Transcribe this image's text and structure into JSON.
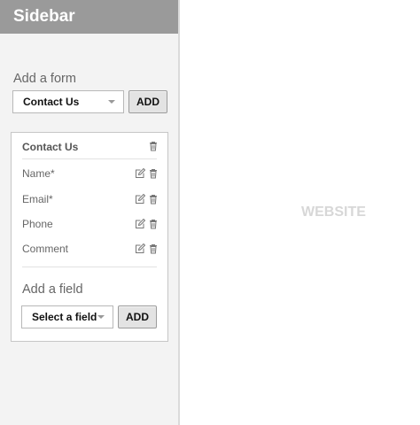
{
  "sidebar": {
    "title": "Sidebar",
    "add_form": {
      "label": "Add a form",
      "select_value": "Contact Us",
      "add_label": "ADD"
    },
    "form_panel": {
      "title": "Contact Us",
      "fields": [
        {
          "label": "Name*"
        },
        {
          "label": "Email*"
        },
        {
          "label": "Phone"
        },
        {
          "label": "Comment"
        }
      ],
      "add_field": {
        "label": "Add a field",
        "select_value": "Select a field",
        "add_label": "ADD"
      }
    }
  },
  "main": {
    "label": "WEBSITE"
  },
  "colors": {
    "header_bg": "#9a9a9a",
    "sidebar_bg": "#f3f3f3",
    "button_bg": "#e3e3e3",
    "website_text": "#d7d7d7"
  },
  "icons": {
    "edit": "edit-icon",
    "delete": "trash-icon"
  }
}
